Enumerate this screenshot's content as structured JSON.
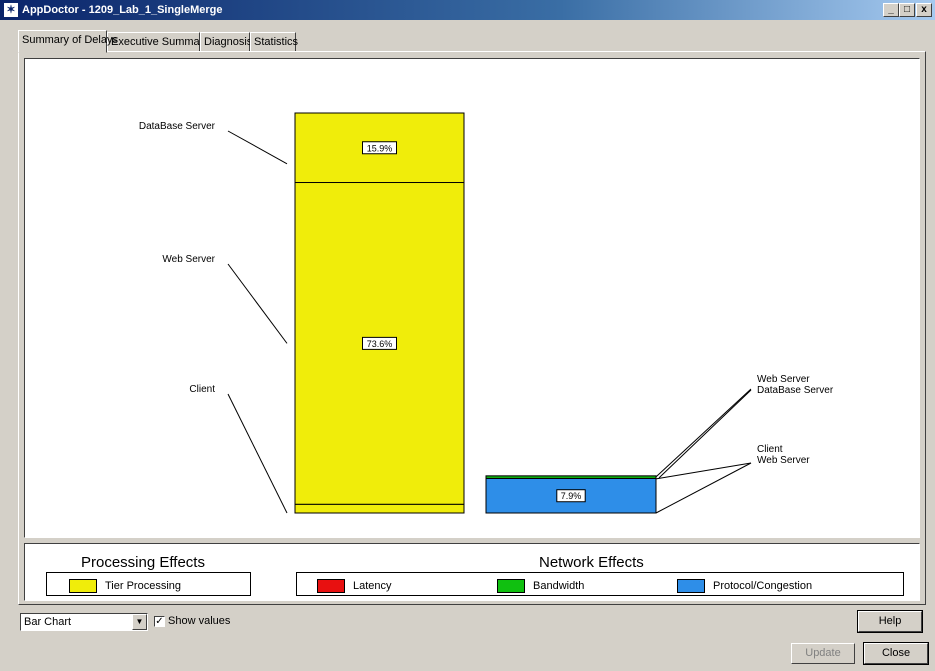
{
  "window": {
    "title": "AppDoctor - 1209_Lab_1_SingleMerge",
    "minimize": "_",
    "maximize": "□",
    "close": "x"
  },
  "tabs": [
    {
      "label": "Summary of Delays",
      "active": true
    },
    {
      "label": "Executive Summary",
      "active": false
    },
    {
      "label": "Diagnosis",
      "active": false
    },
    {
      "label": "Statistics",
      "active": false
    }
  ],
  "chart_data": {
    "type": "bar",
    "stacked": true,
    "categories": [
      "Processing Effects",
      "Network Effects"
    ],
    "series": [
      {
        "category": "Processing Effects",
        "segments": [
          {
            "label": "Client",
            "value": 2.0,
            "color": "#f0ed0a",
            "value_label": ""
          },
          {
            "label": "Web Server",
            "value": 73.6,
            "color": "#f0ed0a",
            "value_label": "73.6%"
          },
          {
            "label": "DataBase Server",
            "value": 15.9,
            "color": "#f0ed0a",
            "value_label": "15.9%"
          }
        ]
      },
      {
        "category": "Network Effects",
        "segments": [
          {
            "label": "Client\nWeb Server",
            "value": 7.9,
            "color": "#2e8ee8",
            "value_label": "7.9%"
          },
          {
            "label": "Web Server\nDataBase Server",
            "value": 0.6,
            "color": "#10b010",
            "value_label": ""
          }
        ]
      }
    ],
    "callouts": {
      "left": [
        "DataBase Server",
        "Web Server",
        "Client"
      ],
      "right": [
        [
          "Web Server",
          "DataBase Server"
        ],
        [
          "Client",
          "Web Server"
        ]
      ]
    }
  },
  "legend": {
    "processing_title": "Processing Effects",
    "network_title": "Network Effects",
    "processing_items": [
      {
        "label": "Tier Processing",
        "color": "#f0ed0a"
      }
    ],
    "network_items": [
      {
        "label": "Latency",
        "color": "#e81010"
      },
      {
        "label": "Bandwidth",
        "color": "#10c010"
      },
      {
        "label": "Protocol/Congestion",
        "color": "#2e8ee8"
      }
    ]
  },
  "controls": {
    "chart_type": "Bar Chart",
    "show_values_label": "Show values",
    "show_values_checked": true,
    "check_mark": "✓",
    "help_label": "Help",
    "update_label": "Update",
    "close_label": "Close"
  }
}
